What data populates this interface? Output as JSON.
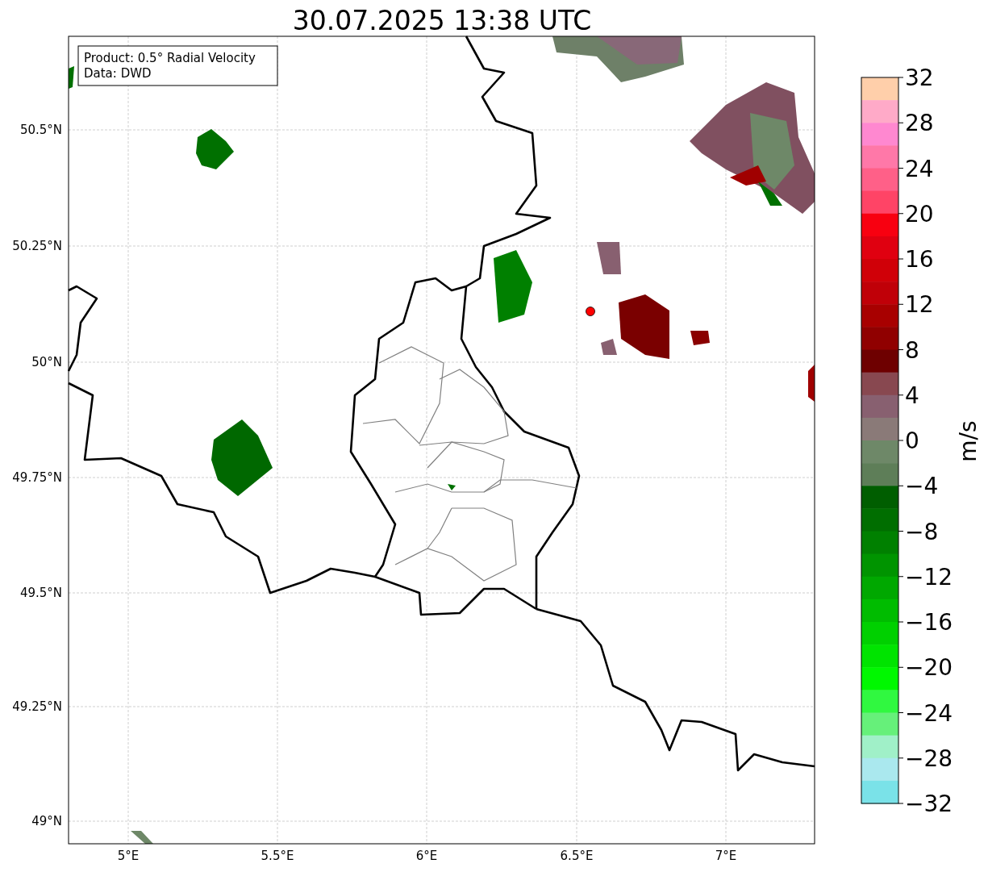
{
  "title": "30.07.2025 13:38 UTC",
  "info_box": [
    "Product: 0.5° Radial Velocity",
    "Data: DWD"
  ],
  "latitude_labels": [
    "50.5°N",
    "50.25°N",
    "50°N",
    "49.75°N",
    "49.5°N",
    "49.25°N",
    "49°N"
  ],
  "longitude_labels": [
    "5°E",
    "5.5°E",
    "6°E",
    "6.5°E",
    "7°E"
  ],
  "colorbar": {
    "label": "m/s",
    "ticks": [
      "32",
      "28",
      "24",
      "20",
      "16",
      "12",
      "8",
      "4",
      "0",
      "−4",
      "−8",
      "−12",
      "−16",
      "−20",
      "−24",
      "−28",
      "−32"
    ],
    "bins": [
      {
        "color": "#ffcfaa"
      },
      {
        "color": "#ffaac8"
      },
      {
        "color": "#ff88d0"
      },
      {
        "color": "#ff78a8"
      },
      {
        "color": "#ff6088"
      },
      {
        "color": "#ff4466"
      },
      {
        "color": "#f80010"
      },
      {
        "color": "#e00010"
      },
      {
        "color": "#d00008"
      },
      {
        "color": "#c00008"
      },
      {
        "color": "#a80000"
      },
      {
        "color": "#900000"
      },
      {
        "color": "#6e0000"
      },
      {
        "color": "#884850"
      },
      {
        "color": "#886070"
      },
      {
        "color": "#8a7a78"
      },
      {
        "color": "#6e8868"
      },
      {
        "color": "#5e7e58"
      },
      {
        "color": "#005e00"
      },
      {
        "color": "#006e00"
      },
      {
        "color": "#008000"
      },
      {
        "color": "#009400"
      },
      {
        "color": "#00a800"
      },
      {
        "color": "#00bc00"
      },
      {
        "color": "#00d000"
      },
      {
        "color": "#00e400"
      },
      {
        "color": "#00f800"
      },
      {
        "color": "#30f840"
      },
      {
        "color": "#66f07a"
      },
      {
        "color": "#a0f0c8"
      },
      {
        "color": "#aae8ee"
      },
      {
        "color": "#7ae2e8"
      }
    ]
  }
}
